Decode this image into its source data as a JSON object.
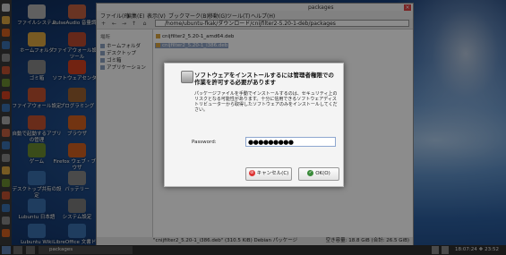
{
  "desktop": {
    "icons": [
      {
        "label": "ファイルシステム",
        "color": "#b0b0b0"
      },
      {
        "label": "PulseAudio 音量調節",
        "color": "#c06040"
      },
      {
        "label": "ホームフォルダ",
        "color": "#d9a441"
      },
      {
        "label": "ファイアウォール設定ツール",
        "color": "#b84a30"
      },
      {
        "label": "ゴミ箱",
        "color": "#888"
      },
      {
        "label": "ソフトウェアセンター",
        "color": "#d04020"
      },
      {
        "label": "ファイアウォール設定",
        "color": "#c05030"
      },
      {
        "label": "プログラミング",
        "color": "#9a6030"
      },
      {
        "label": "自動で起動するアプリの管理",
        "color": "#c05030"
      },
      {
        "label": "ブラウザ",
        "color": "#d06020"
      },
      {
        "label": "ゲーム",
        "color": "#6a8a30"
      },
      {
        "label": "Firefox ウェブ・ブラウザ",
        "color": "#d06020"
      },
      {
        "label": "デスクトップ共有の設定",
        "color": "#3a6fae"
      },
      {
        "label": "バッテリー",
        "color": "#888"
      },
      {
        "label": "Lubuntu 日本語",
        "color": "#3a6fae"
      },
      {
        "label": "システム設定",
        "color": "#7a7a7a"
      },
      {
        "label": "Lubuntu Wiki",
        "color": "#3a6fae"
      },
      {
        "label": "LibreOffice 文書ドキュメント",
        "color": "#3a6fae"
      }
    ]
  },
  "file_manager": {
    "title": "packages",
    "menu": [
      "ファイル(F)",
      "編集(E)",
      "表示(V)",
      "ブックマーク(B)",
      "移動(G)",
      "ツール(T)",
      "ヘルプ(H)"
    ],
    "path": "/home/ubuntu-fkak/ダウンロード/cnijfilter2-5.20-1-deb/packages",
    "sidebar_header": "場所",
    "sidebar": [
      "ホームフォルダ",
      "デスクトップ",
      "ゴミ箱",
      "アプリケーション"
    ],
    "files": [
      {
        "name": "cnijfilter2_5.20-1_amd64.deb",
        "selected": false
      },
      {
        "name": "cnijfilter2_5.20-1_i386.deb",
        "selected": true
      }
    ],
    "status_left": "\"cnijfilter2_5.20-1_i386.deb\" (310.5 KiB) Debian パッケージ",
    "status_right": "空き容量: 18.8 GiB (合計: 26.5 GiB)"
  },
  "dialog": {
    "title": "ソフトウェアをインストールするには管理者権限での作業を許可する必要があります",
    "body": "パッケージファイルを手動でインストールするのは、セキュリティ上のリスクとなる可能性があります。十分に信用できるソフトウェアディストリビューターから取得したソフトウェアのみをインストールしてください。",
    "password_label": "Password:",
    "password_value": "●●●●●●●●●",
    "cancel_label": "キャンセル(C)",
    "ok_label": "OK(O)"
  },
  "taskbar": {
    "window_label": "packages",
    "clock": "18:07:24 ❖ 23:52"
  }
}
